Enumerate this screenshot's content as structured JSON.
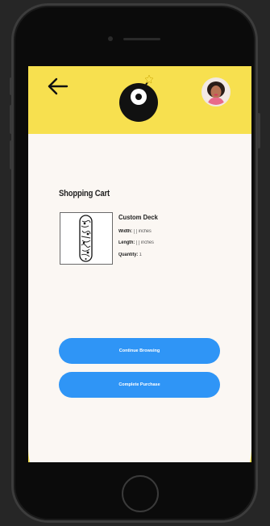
{
  "header": {
    "back_label": "Back",
    "avatar_label": "Profile"
  },
  "cart": {
    "title": "Shopping Cart",
    "item": {
      "name": "Custom Deck",
      "width_label": "Width:",
      "width_value": "[ ] inches",
      "length_label": "Length:",
      "length_value": "[ ] inches",
      "quantity_label": "Quantity:",
      "quantity_value": "1"
    }
  },
  "actions": {
    "continue_label": "Continue Browsing",
    "complete_label": "Complete Purchase"
  },
  "colors": {
    "accent_yellow": "#f7e04f",
    "button_blue": "#2f95f6",
    "sheet_bg": "#fbf7f3"
  },
  "icons": {
    "back": "arrow-left-icon",
    "logo": "bomb-logo-icon",
    "avatar": "user-avatar"
  }
}
